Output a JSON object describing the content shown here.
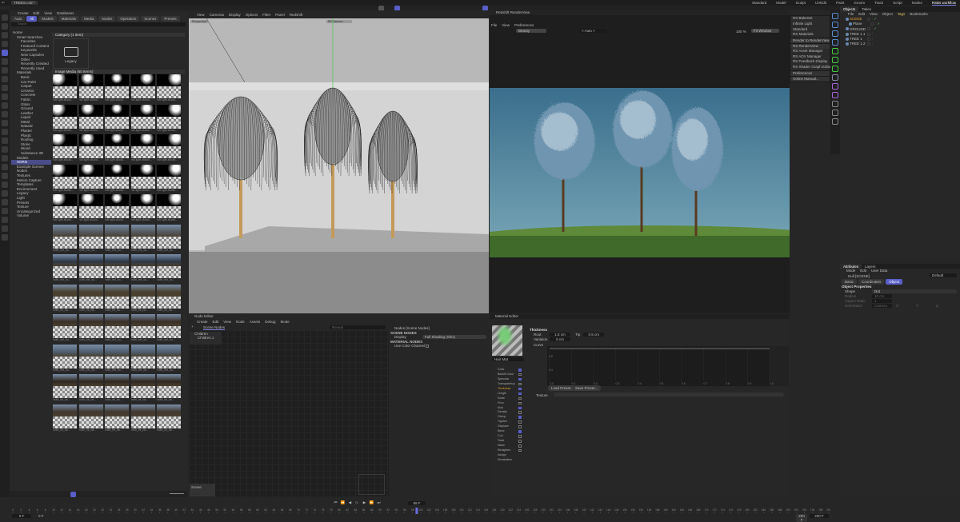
{
  "top": {
    "file_tab": "TREES.c4d *",
    "layouts": [
      "Standard",
      "Model",
      "Sculpt",
      "UVEdit",
      "Paint",
      "Groom",
      "Track",
      "Script",
      "Nodes",
      "RSBs workflow"
    ],
    "active_layout": "RSBs workflow"
  },
  "content_browser": {
    "menu": [
      "Create",
      "Edit",
      "View",
      "Databases"
    ],
    "filters": [
      "Auto",
      "All",
      "Models",
      "Materials",
      "Media",
      "Nodes",
      "Operators",
      "Scenes",
      "Presets"
    ],
    "active_filter": "All",
    "search_placeholder": "Search",
    "tree": [
      {
        "label": "Home",
        "level": 0
      },
      {
        "label": "Smart Searches",
        "level": 1
      },
      {
        "label": "Favorites",
        "level": 2
      },
      {
        "label": "Featured Content",
        "level": 2
      },
      {
        "label": "Keywords",
        "level": 2
      },
      {
        "label": "New Capsules",
        "level": 2
      },
      {
        "label": "Other",
        "level": 2
      },
      {
        "label": "Recently Created",
        "level": 2
      },
      {
        "label": "Recently Used",
        "level": 2
      },
      {
        "label": "Materials",
        "level": 1
      },
      {
        "label": "Basic",
        "level": 2
      },
      {
        "label": "Car Paint",
        "level": 2
      },
      {
        "label": "Carpet",
        "level": 2
      },
      {
        "label": "Ceramic",
        "level": 2
      },
      {
        "label": "Concrete",
        "level": 2
      },
      {
        "label": "Fabric",
        "level": 2
      },
      {
        "label": "Glass",
        "level": 2
      },
      {
        "label": "Ground",
        "level": 2
      },
      {
        "label": "Leather",
        "level": 2
      },
      {
        "label": "Liquid",
        "level": 2
      },
      {
        "label": "Metal",
        "level": 2
      },
      {
        "label": "Natural",
        "level": 2
      },
      {
        "label": "Plaster",
        "level": 2
      },
      {
        "label": "Plastic",
        "level": 2
      },
      {
        "label": "Roofing",
        "level": 2
      },
      {
        "label": "Stone",
        "level": 2
      },
      {
        "label": "Wood",
        "level": 2
      },
      {
        "label": "Substance 3D",
        "level": 2
      },
      {
        "label": "Models",
        "level": 1
      },
      {
        "label": "HDRIs",
        "level": 1,
        "selected": true
      },
      {
        "label": "Example Scenes",
        "level": 1
      },
      {
        "label": "Nodes",
        "level": 1
      },
      {
        "label": "Textures",
        "level": 1
      },
      {
        "label": "Motion Capture",
        "level": 1
      },
      {
        "label": "Templates",
        "level": 1
      },
      {
        "label": "Environment",
        "level": 1
      },
      {
        "label": "Legacy",
        "level": 1
      },
      {
        "label": "Light",
        "level": 1
      },
      {
        "label": "Presets",
        "level": 1
      },
      {
        "label": "Texture",
        "level": 1
      },
      {
        "label": "Uncategorized",
        "level": 1
      },
      {
        "label": "Volume",
        "level": 1
      }
    ],
    "category_header": "Category (1 Item)",
    "category_item": "Legacy",
    "media_header": "Image Media (60 Items)",
    "captions": [
      "hdr-light-studio...",
      "hdr-light-studio...",
      "hdr-light-studio...",
      "hdr-light-studio...",
      "hdr-light-studio...",
      "hdr-light-studio...",
      "hdr-light-studio...",
      "hdr-light-studio...",
      "hdr-light-studio...",
      "hdr-light-studio...",
      "hdr-light-studio...",
      "hdr-light-studio...",
      "hdr-light-studio...",
      "hdr-light-studio...",
      "hdr-light-studio...",
      "hdr-light-studio...",
      "hdr-light-studio...",
      "hdr-light-studio...",
      "hdr-light-studio...",
      "hdr-light-studio...",
      "hdr-light-studio...",
      "hdr-light-studio...",
      "hdr-light-studio...",
      "hdr-light-studio...",
      "hdr-light-studio...",
      "indirl_ext_ou...",
      "indirl_ext_ou...",
      "indirl_ext_ou...",
      "indirl_ext_ou...",
      "indirl_ext_ou...",
      "indirl_ext_ou...",
      "indirl_ext_ou...",
      "indirl_ext_ou...",
      "indirl_ext_ou...",
      "indirl_ext_ou...",
      "indirl_int_ba...",
      "indirl_int_ba...",
      "indirl_int_ba...",
      "indirl_int_ba...",
      "indirl_int_ba...",
      "indirl_ext_ou...",
      "indirl_ext_ou...",
      "indirl_ext_ou...",
      "indirl_ext_ou...",
      "indirl_ext_ou...",
      "indirl_ext_ou...",
      "indirl_ext_ou...",
      "indirl_ext_ou...",
      "indirl_ext_ou...",
      "indirl_ext_ou...",
      "indirl_int_ba...",
      "indirl_int_ba...",
      "indirl_int_ba...",
      "indirl_int_ba...",
      "indirl_int_ba...",
      "indirl_int_ba...",
      "indirl_int_ba...",
      "indirl_int_ba...",
      "indirl_int_ba...",
      "indirl_int_ba..."
    ]
  },
  "viewport": {
    "menu": [
      "View",
      "Cameras",
      "Display",
      "Options",
      "Filter",
      "Panel",
      "Redshift"
    ],
    "label": "Perspective",
    "camera": "RS Camera"
  },
  "renderview": {
    "title": "Redshift RenderView",
    "menu": [
      "File",
      "View",
      "Preferences"
    ],
    "aov": "Beauty",
    "region": "< Auto >",
    "zoom": "100 %",
    "fit": "Fit Window"
  },
  "redshift_menu": [
    "RS BakeSet",
    "Infinite Light",
    "Standard",
    "RS Materials",
    "Render to RenderView",
    "RS RenderView",
    "RS Asset Manager",
    "RS AOV Manager",
    "RS Feedback Display",
    "RS Shader Graph Editor",
    "Preferences",
    "Online Manual..."
  ],
  "objects": {
    "tabs": [
      "Objects",
      "Takes"
    ],
    "menu": [
      "File",
      "Edit",
      "View",
      "Object",
      "Tags",
      "Bookmarks"
    ],
    "items": [
      {
        "name": "SCENE",
        "color": "#e0a030"
      },
      {
        "name": "Plane",
        "color": "#bdbdbd"
      },
      {
        "name": "GROUND",
        "color": "#bdbdbd"
      },
      {
        "name": "TREE 1.1",
        "color": "#bdbdbd"
      },
      {
        "name": "TREE 1",
        "color": "#bdbdbd"
      },
      {
        "name": "TREE 1.2",
        "color": "#bdbdbd"
      }
    ]
  },
  "attributes": {
    "tabs": [
      "Attributes",
      "Layers"
    ],
    "menu": [
      "Mode",
      "Edit",
      "User Data"
    ],
    "object": "Null [SCENE]",
    "preset": "Default",
    "subtabs": [
      "Basic",
      "Coordinates",
      "Object"
    ],
    "active_subtab": "Object",
    "section": "Object Properties",
    "props": [
      {
        "label": "Shape",
        "value": "Dot"
      },
      {
        "label": "Radius",
        "value": "10 cm"
      },
      {
        "label": "Aspect Ratio",
        "value": "1"
      },
      {
        "label": "Orientation",
        "value": "Camera"
      }
    ],
    "axes": [
      "X",
      "Y",
      "Z"
    ]
  },
  "node_editor": {
    "title": "Node Editor",
    "menu": [
      "Create",
      "Edit",
      "View",
      "Node",
      "Assets",
      "Debug",
      "Mode"
    ],
    "tab": "Scene Nodes",
    "search_placeholder": "Reveal",
    "tree": [
      "Children",
      "Children.1"
    ],
    "panel_title": "Nodes [Scene Nodes]",
    "scene_nodes": "SCENE NODES",
    "display_label": "Display",
    "display_value": "Full Shading (Shiv)",
    "material_nodes": "MATERIAL NODES",
    "use_color": "Use Color Channel",
    "bottom_label": "Scene"
  },
  "material_editor": {
    "title": "Material Editor",
    "name": "Hair Mat",
    "section": "Thickness",
    "root_label": "Root",
    "root": "1.5 cm",
    "tip_label": "Tip",
    "tip": "0.5 cm",
    "variation_label": "Variation",
    "variation": "0 cm",
    "curve_label": "Curve",
    "curve_x_ticks": [
      "0.0",
      "0.1",
      "0.2",
      "0.3",
      "0.4",
      "0.5",
      "0.6",
      "0.7",
      "0.8",
      "0.9",
      "1.0"
    ],
    "curve_y_ticks": [
      "0.8",
      "0.4"
    ],
    "load_preset": "Load Preset...",
    "save_preset": "Save Preset...",
    "texture_label": "Texture",
    "channels": [
      {
        "label": "Color",
        "on": true
      },
      {
        "label": "Backlit Color",
        "on": false
      },
      {
        "label": "Specular",
        "on": true
      },
      {
        "label": "Transparency",
        "on": false
      },
      {
        "label": "Thickness",
        "on": true,
        "active": true
      },
      {
        "label": "Length",
        "on": true
      },
      {
        "label": "Scale",
        "on": false
      },
      {
        "label": "Frizz",
        "on": false
      },
      {
        "label": "Kink",
        "on": true
      },
      {
        "label": "Density",
        "on": false
      },
      {
        "label": "Clump",
        "on": true
      },
      {
        "label": "Tighten",
        "on": false
      },
      {
        "label": "Displace",
        "on": false
      },
      {
        "label": "Bend",
        "on": true
      },
      {
        "label": "Curl",
        "on": false
      },
      {
        "label": "Twist",
        "on": false
      },
      {
        "label": "Wave",
        "on": false
      },
      {
        "label": "Straighten",
        "on": false
      },
      {
        "label": "Assign"
      },
      {
        "label": "Illumination"
      }
    ]
  },
  "timeline": {
    "start": "0 F",
    "start2": "0 F",
    "current": "99 F",
    "end": "200 F",
    "end2": "200 F",
    "min": 0,
    "max": 200,
    "step": 2,
    "current_frame": 99
  }
}
